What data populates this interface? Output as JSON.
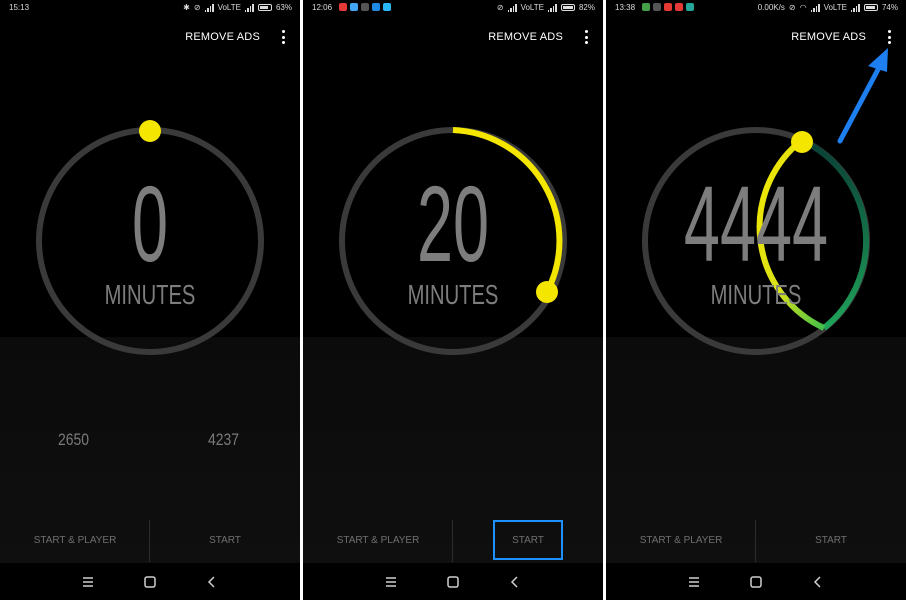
{
  "header": {
    "remove_ads": "REMOVE ADS"
  },
  "common": {
    "unit": "MINUTES",
    "start_player": "START & PLAYER",
    "start": "START"
  },
  "panels": [
    {
      "status": {
        "time": "15:13",
        "network": "",
        "volte": "VoLTE",
        "battery": "63%"
      },
      "dial_value": "0",
      "stats": [
        "2650",
        "4237"
      ],
      "progress_fraction": 0.0
    },
    {
      "status": {
        "time": "12:06",
        "network": "",
        "volte": "VoLTE",
        "battery": "82%"
      },
      "dial_value": "20",
      "stats": [],
      "progress_fraction": 0.35
    },
    {
      "status": {
        "time": "13:38",
        "network": "0.00K/s",
        "volte": "VoLTE",
        "battery": "74%"
      },
      "dial_value": "4444",
      "stats": [],
      "progress_fraction": 0.9
    }
  ],
  "colors": {
    "accent_yellow": "#f5e600",
    "highlight_blue": "#1e90ff",
    "gradient_green": "#0a5c4a"
  }
}
